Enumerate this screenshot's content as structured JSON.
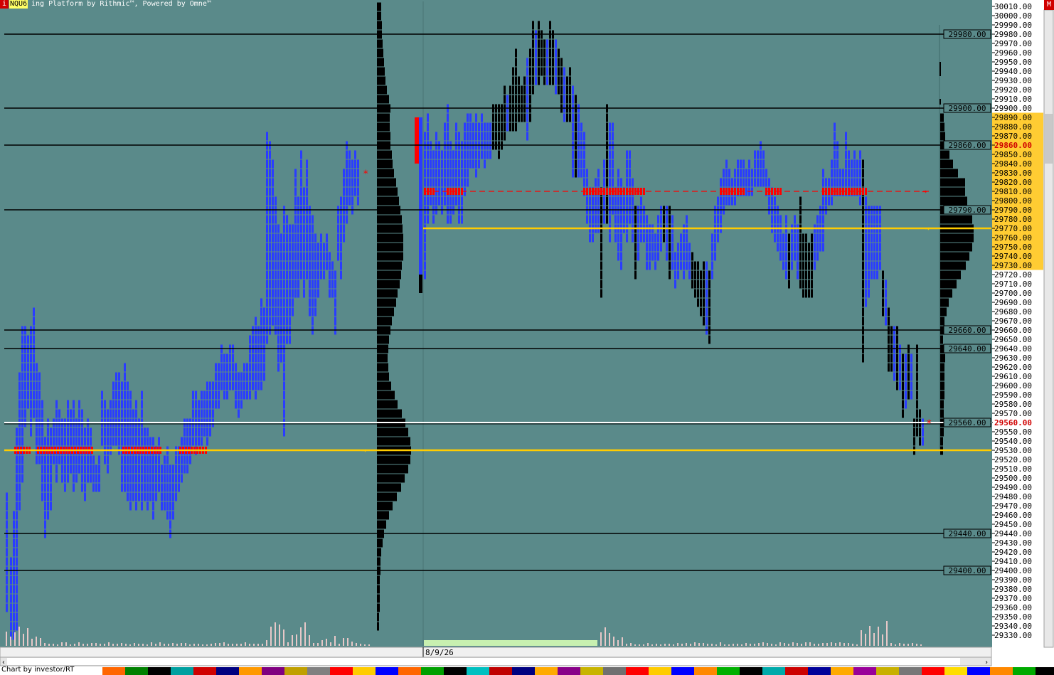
{
  "window": {
    "symbol": "NQU6",
    "title_suffix": "ing Platform by Rithmic™, Powered by Omne™",
    "left_badge": "i",
    "right_badge": "M"
  },
  "footer": {
    "credit": "Chart by investor/RT",
    "date_label": "8/9/26"
  },
  "colors": {
    "background": "#5a8a8a",
    "tpo_blue": "#2a3cff",
    "tpo_black": "#000000",
    "poc_red": "#ff0000",
    "value_yellow": "#ffcc00",
    "axis_highlight": "#ffcc33"
  },
  "price_axis": {
    "max": 30010,
    "min": 29330,
    "step": 10,
    "highlighted_range": [
      29730,
      29890
    ],
    "current_price": 29560,
    "current_price_label": "29560.00",
    "highlight_red_label": "29860.00",
    "top_label": "30010.00"
  },
  "reference_lines": [
    {
      "price": 29980,
      "label": "29980.00"
    },
    {
      "price": 29900,
      "label": "29900.00"
    },
    {
      "price": 29860,
      "label": "29860.00"
    },
    {
      "price": 29790,
      "label": "29790.00"
    },
    {
      "price": 29660,
      "label": "29660.00"
    },
    {
      "price": 29640,
      "label": "29640.00"
    },
    {
      "price": 29560,
      "label": "29560.00"
    },
    {
      "price": 29440,
      "label": "29440.00"
    },
    {
      "price": 29400,
      "label": "29400.00"
    }
  ],
  "value_lines": [
    {
      "price": 29530,
      "session": "previous"
    },
    {
      "price": 29770,
      "session": "current"
    }
  ],
  "poc_lines": [
    {
      "price": 29810,
      "session": "current"
    },
    {
      "price": 29530,
      "session": "previous"
    }
  ]
}
